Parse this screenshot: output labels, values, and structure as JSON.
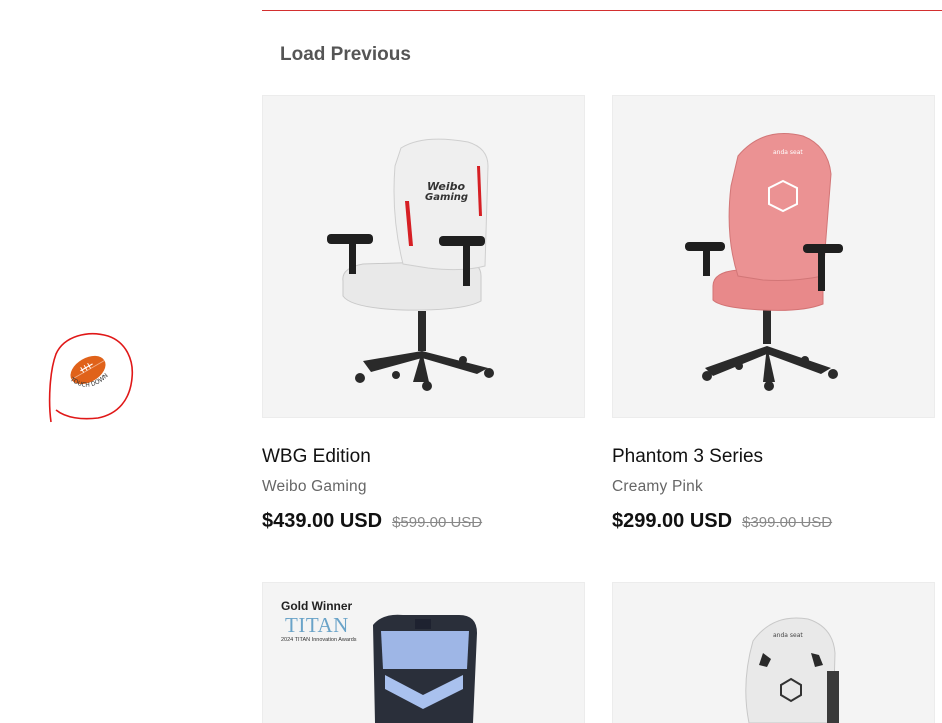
{
  "load_previous": "Load Previous",
  "badge": {
    "icon": "football-icon",
    "text": "TOUCH DOWN"
  },
  "products": [
    {
      "title": "WBG Edition",
      "subtitle": "Weibo Gaming",
      "price": "$439.00 USD",
      "old_price": "$599.00 USD",
      "chair_color": "#eeeeee",
      "image_text": "Weibo Gaming"
    },
    {
      "title": "Phantom 3 Series",
      "subtitle": "Creamy Pink",
      "price": "$299.00 USD",
      "old_price": "$399.00 USD",
      "chair_color": "#e8898a"
    },
    {
      "award_title": "Gold Winner",
      "award_name": "TITAN",
      "award_sub": "2024 TITAN Innovation Awards"
    },
    {
      "chair_color": "#e9e9e9"
    }
  ],
  "colors": {
    "accent_rule": "#d32f2f",
    "badge_ring": "#e01818",
    "football": "#e0621a"
  }
}
